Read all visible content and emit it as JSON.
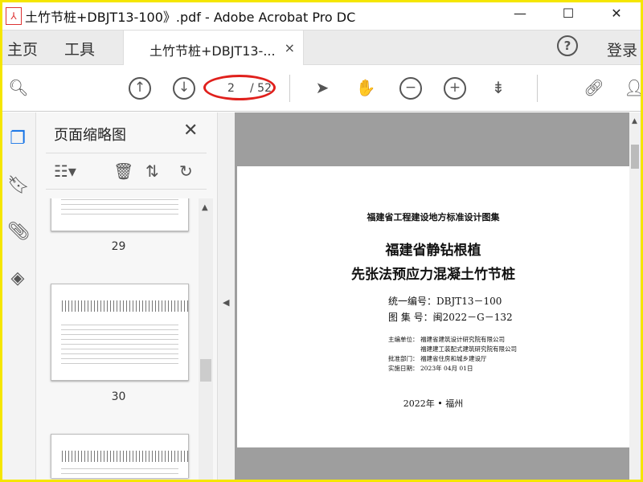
{
  "window": {
    "title": "土竹节桩+DBJT13-100》.pdf - Adobe Acrobat Pro DC",
    "minimize": "—",
    "maximize": "☐",
    "close": "✕"
  },
  "tabs": {
    "home": "主页",
    "tools": "工具",
    "document": "土竹节桩+DBJT13-...",
    "close": "×",
    "help": "?",
    "login": "登录"
  },
  "toolbar": {
    "current_page": "2",
    "total_pages": "/ 52"
  },
  "panel": {
    "title": "页面缩略图",
    "close": "✕",
    "thumbnails": [
      {
        "label": "29"
      },
      {
        "label": "30"
      },
      {
        "label": ""
      }
    ]
  },
  "page": {
    "series": "福建省工程建设地方标准设计图集",
    "title_line1": "福建省静钻根植",
    "title_line2": "先张法预应力混凝土竹节桩",
    "code_label": "统一编号：",
    "code": "DBJT13－100",
    "atlas_label": "图 集 号：",
    "atlas": "闽2022－G－132",
    "editor_label": "主编单位：",
    "editor1": "福建省建筑设计研究院有限公司",
    "editor2": "福建建工装配式建筑研究院有限公司",
    "approver_label": "批准部门：",
    "approver": "福建省住房和城乡建设厅",
    "date_label": "实施日期：",
    "date": "2023年 04月 01日",
    "footer": "2022年 • 福州"
  },
  "colors": {
    "annotation": "#e0201c",
    "border": "#f5e600"
  }
}
